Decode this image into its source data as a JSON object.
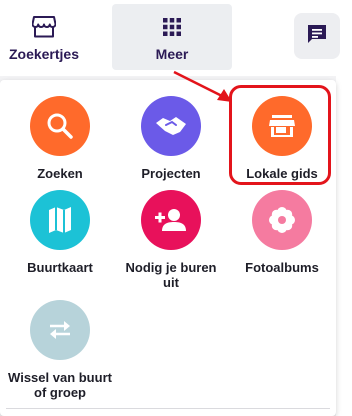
{
  "nav": {
    "tabs": [
      {
        "label": "Zoekertjes",
        "icon": "storefront-icon"
      },
      {
        "label": "Meer",
        "icon": "grid-icon",
        "active": true
      }
    ],
    "chat_icon": "chat-icon"
  },
  "menu": {
    "items": [
      {
        "label": "Zoeken",
        "icon": "search-icon",
        "color": "#ff6a2b"
      },
      {
        "label": "Projecten",
        "icon": "handshake-icon",
        "color": "#6b5ae8"
      },
      {
        "label": "Lokale gids",
        "icon": "store-icon",
        "color": "#ff6a2b",
        "highlighted": true
      },
      {
        "label": "Buurtkaart",
        "icon": "map-icon",
        "color": "#1cc2d6"
      },
      {
        "label": "Nodig je buren uit",
        "icon": "add-person-icon",
        "color": "#e8115b"
      },
      {
        "label": "Fotoalbums",
        "icon": "flower-icon",
        "color": "#f57ba0"
      },
      {
        "label": "Wissel van buurt of groep",
        "icon": "swap-icon",
        "color": "#b7d3da"
      }
    ]
  },
  "colors": {
    "brand_dark": "#2b1a55",
    "annotation_red": "#e3141b"
  }
}
